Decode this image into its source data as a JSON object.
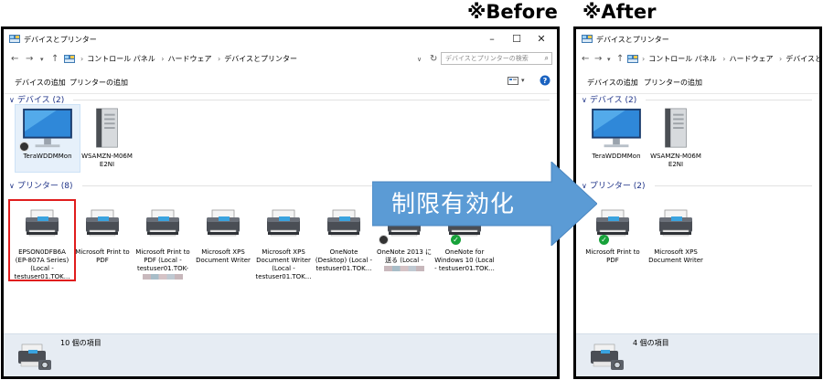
{
  "captions": {
    "before": "※Before",
    "after": "※After"
  },
  "arrow_text": "制限有効化",
  "before": {
    "title": "デバイスとプリンター",
    "breadcrumb": [
      "コントロール パネル",
      "ハードウェア",
      "デバイスとプリンター"
    ],
    "search_placeholder": "デバイスとプリンターの検索",
    "toolbar": {
      "add_device": "デバイスの追加",
      "add_printer": "プリンターの追加"
    },
    "devices_header": "デバイス (2)",
    "devices": [
      {
        "label": "TeraWDDMMon",
        "icon": "monitor-icon"
      },
      {
        "label": "WSAMZN-M06M E2NI",
        "icon": "server-icon"
      }
    ],
    "printers_header": "プリンター (8)",
    "printers": [
      {
        "label": "EPSON0DFB6A (EP-807A Series) (Local - testuser01.TOK...",
        "icon": "printer-icon"
      },
      {
        "label": "Microsoft Print to PDF",
        "icon": "printer-icon"
      },
      {
        "label": "Microsoft Print to PDF (Local - testuser01.TOK-",
        "icon": "printer-icon"
      },
      {
        "label": "Microsoft XPS Document Writer",
        "icon": "printer-icon"
      },
      {
        "label": "Microsoft XPS Document Writer (Local - testuser01.TOK...",
        "icon": "printer-icon"
      },
      {
        "label": "OneNote (Desktop) (Local - testuser01.TOK...",
        "icon": "printer-icon"
      },
      {
        "label": "OneNote 2013 に送る (Local -",
        "icon": "printer-icon"
      },
      {
        "label": "OneNote for Windows 10 (Local - testuser01.TOK...",
        "icon": "printer-icon"
      }
    ],
    "status": "10 個の項目"
  },
  "after": {
    "title": "デバイスとプリンター",
    "breadcrumb": [
      "コントロール パネル",
      "ハードウェア",
      "デバイスとプリンター"
    ],
    "toolbar": {
      "add_device": "デバイスの追加",
      "add_printer": "プリンターの追加"
    },
    "devices_header": "デバイス (2)",
    "devices": [
      {
        "label": "TeraWDDMMon",
        "icon": "monitor-icon"
      },
      {
        "label": "WSAMZN-M06M E2NI",
        "icon": "server-icon"
      }
    ],
    "printers_header": "プリンター (2)",
    "printers": [
      {
        "label": "Microsoft Print to PDF",
        "icon": "printer-icon"
      },
      {
        "label": "Microsoft XPS Document Writer",
        "icon": "printer-icon"
      }
    ],
    "status": "4 個の項目"
  },
  "colors": {
    "accent_blue": "#1e3287",
    "arrow_blue": "#5b9bd5",
    "highlight_red": "#e01d1d",
    "check_green": "#17a23a"
  }
}
